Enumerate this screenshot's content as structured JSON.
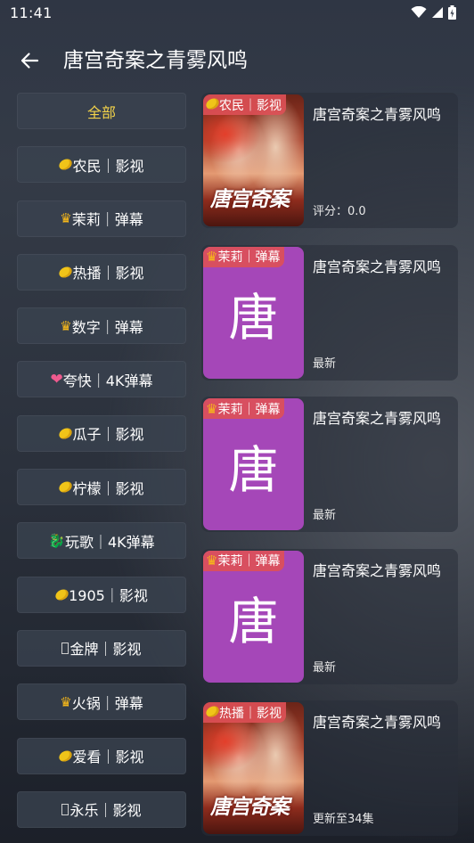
{
  "status_bar": {
    "time": "11:41"
  },
  "header": {
    "title": "唐宫奇案之青雾风鸣"
  },
  "sources": [
    {
      "label": "全部",
      "icon": "",
      "active": true
    },
    {
      "label": "农民｜影视",
      "icon": "lemon-icon"
    },
    {
      "label": "茉莉｜弹幕",
      "icon": "crown-icon"
    },
    {
      "label": "热播｜影视",
      "icon": "lemon-icon"
    },
    {
      "label": "数字｜弹幕",
      "icon": "crown-icon"
    },
    {
      "label": "夸快｜4K弹幕",
      "icon": "heart-icon"
    },
    {
      "label": "瓜子｜影视",
      "icon": "lemon-icon"
    },
    {
      "label": "柠檬｜影视",
      "icon": "lemon-icon"
    },
    {
      "label": "玩歌｜4K弹幕",
      "icon": "dragon-icon"
    },
    {
      "label": "1905｜影视",
      "icon": "lemon-icon"
    },
    {
      "label": "金牌｜影视",
      "icon": "box-icon"
    },
    {
      "label": "火锅｜弹幕",
      "icon": "crown-icon"
    },
    {
      "label": "爱看｜影视",
      "icon": "lemon-icon"
    },
    {
      "label": "永乐｜影视",
      "icon": "box-icon"
    }
  ],
  "results": [
    {
      "source": "农民｜影视",
      "source_icon": "lemon-icon",
      "title": "唐宫奇案之青雾风鸣",
      "meta": "评分：0.0",
      "poster": "drama",
      "poster_text": "唐宫奇案"
    },
    {
      "source": "茉莉｜弹幕",
      "source_icon": "crown-icon",
      "title": "唐宫奇案之青雾风鸣",
      "meta": "最新",
      "poster": "letter",
      "poster_text": "唐",
      "poster_color": "#a547b8"
    },
    {
      "source": "茉莉｜弹幕",
      "source_icon": "crown-icon",
      "title": "唐宫奇案之青雾风鸣",
      "meta": "最新",
      "poster": "letter",
      "poster_text": "唐",
      "poster_color": "#a547b8"
    },
    {
      "source": "茉莉｜弹幕",
      "source_icon": "crown-icon",
      "title": "唐宫奇案之青雾风鸣",
      "meta": "最新",
      "poster": "letter",
      "poster_text": "唐",
      "poster_color": "#a547b8"
    },
    {
      "source": "热播｜影视",
      "source_icon": "lemon-icon",
      "title": "唐宫奇案之青雾风鸣",
      "meta": "更新至34集",
      "poster": "drama",
      "poster_text": "唐宫奇案"
    }
  ],
  "colors": {
    "active_chip": "#f3d34a",
    "source_tag": "#de5056",
    "letter_poster": "#a547b8"
  }
}
